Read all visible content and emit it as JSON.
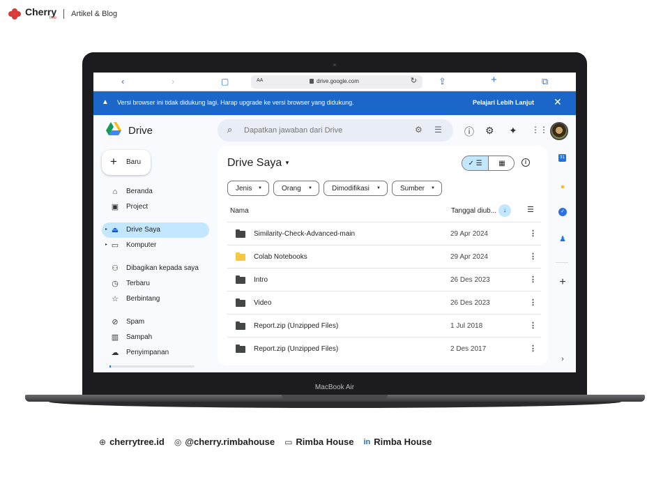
{
  "brand": {
    "name": "Cherry",
    "sub": "tree",
    "tagline": "Artikel & Blog"
  },
  "device": {
    "label": "MacBook Air"
  },
  "safari": {
    "back_icon": "chevron-left-icon",
    "forward_icon": "chevron-right-icon",
    "bookmarks_icon": "book-icon",
    "reader_label": "AA",
    "url": "drive.google.com",
    "reload_icon": "reload-icon",
    "share_icon": "share-icon",
    "newtab_icon": "plus-icon",
    "tabs_icon": "tabs-icon"
  },
  "banner": {
    "text": "Versi browser ini tidak didukung lagi. Harap upgrade ke versi browser yang didukung.",
    "link": "Pelajari Lebih Lanjut",
    "close": "✕",
    "color": "#1a66c9"
  },
  "drive": {
    "title": "Drive",
    "search_placeholder": "Dapatkan jawaban dari Drive",
    "new_label": "Baru",
    "nav": [
      {
        "label": "Beranda",
        "icon": "home-icon"
      },
      {
        "label": "Project",
        "icon": "shared-drive-icon"
      },
      {
        "label": "Drive Saya",
        "icon": "my-drive-icon",
        "active": true
      },
      {
        "label": "Komputer",
        "icon": "computer-icon"
      },
      {
        "label": "Dibagikan kepada saya",
        "icon": "people-icon"
      },
      {
        "label": "Terbaru",
        "icon": "clock-icon"
      },
      {
        "label": "Berbintang",
        "icon": "star-icon"
      },
      {
        "label": "Spam",
        "icon": "spam-icon"
      },
      {
        "label": "Sampah",
        "icon": "trash-icon"
      },
      {
        "label": "Penyimpanan",
        "icon": "cloud-icon"
      }
    ],
    "storage_fraction": 0.02,
    "main_title": "Drive Saya",
    "filters": [
      "Jenis",
      "Orang",
      "Dimodifikasi",
      "Sumber"
    ],
    "columns": {
      "name": "Nama",
      "date": "Tanggal diub..."
    },
    "files": [
      {
        "name": "Similarity-Check-Advanced-main",
        "date": "29 Apr 2024",
        "color": "#444746"
      },
      {
        "name": "Colab Notebooks",
        "date": "29 Apr 2024",
        "color": "#f6c744"
      },
      {
        "name": "Intro",
        "date": "26 Des 2023",
        "color": "#444746"
      },
      {
        "name": "Video",
        "date": "26 Des 2023",
        "color": "#444746"
      },
      {
        "name": "Report.zip (Unzipped Files)",
        "date": "1 Jul 2018",
        "color": "#444746"
      },
      {
        "name": "Report.zip (Unzipped Files)",
        "date": "2 Des 2017",
        "color": "#444746"
      }
    ],
    "rail": {
      "calendar_label": "31"
    }
  },
  "footer": {
    "website": "cherrytree.id",
    "instagram": "@cherry.rimbahouse",
    "youtube": "Rimba House",
    "linkedin": "Rimba House",
    "linkedin_mark": "in"
  }
}
